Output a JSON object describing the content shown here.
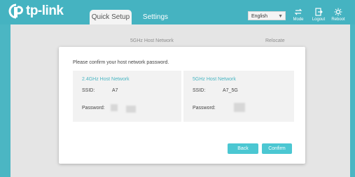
{
  "brand": {
    "name": "tp-link"
  },
  "tabs": [
    {
      "label": "Quick Setup",
      "active": true
    },
    {
      "label": "Settings",
      "active": false
    }
  ],
  "language": {
    "selected": "English"
  },
  "top_actions": [
    {
      "label": "Mode",
      "icon": "mode-icon"
    },
    {
      "label": "Logout",
      "icon": "logout-icon"
    },
    {
      "label": "Reboot",
      "icon": "reboot-icon"
    }
  ],
  "background": {
    "center_label": "5GHz Host Network",
    "right_label": "Relocate"
  },
  "dialog": {
    "prompt": "Please confirm your host network password.",
    "left": {
      "title": "2.4GHz Host Network",
      "ssid_label": "SSID:",
      "ssid_value": "A7",
      "password_label": "Password:"
    },
    "right": {
      "title": "5GHz Host Network",
      "ssid_label": "SSID:",
      "ssid_value": "A7_5G",
      "password_label": "Password:"
    },
    "back_label": "Back",
    "confirm_label": "Confirm"
  },
  "colors": {
    "accent": "#4bb6c3",
    "button": "#4bc7d2",
    "panel": "#f2f2f2"
  }
}
